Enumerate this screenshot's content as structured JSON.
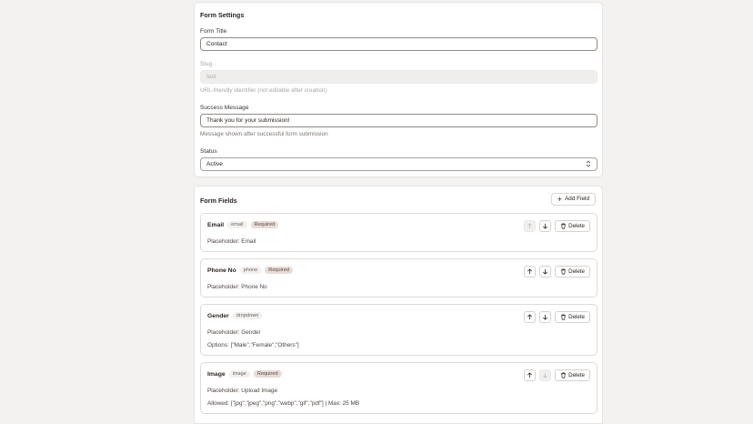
{
  "settings": {
    "title": "Form Settings",
    "form_title_label": "Form Title",
    "form_title_value": "Contact",
    "slug_label": "Slug",
    "slug_value": "test",
    "slug_help": "URL-friendly identifier (not editable after creation)",
    "success_label": "Success Message",
    "success_value": "Thank you for your submission!",
    "success_help": "Message shown after successful form submission",
    "status_label": "Status",
    "status_value": "Active"
  },
  "fields_section": {
    "title": "Form Fields",
    "add_label": "Add Field",
    "delete_label": "Delete",
    "items": [
      {
        "name": "Email",
        "type": "email",
        "required": "Required",
        "placeholder": "Placeholder: Email",
        "can_move_up": false,
        "can_move_down": true
      },
      {
        "name": "Phone No",
        "type": "phone",
        "required": "Required",
        "placeholder": "Placeholder: Phone No",
        "can_move_up": true,
        "can_move_down": true
      },
      {
        "name": "Gender",
        "type": "dropdown",
        "placeholder": "Placeholder: Gender",
        "extra": "Options: [\"Male\",\"Female\",\"Others\"]",
        "can_move_up": true,
        "can_move_down": true
      },
      {
        "name": "Image",
        "type": "image",
        "required": "Required",
        "placeholder": "Placeholder: Upload Image",
        "extra": "Allowed: [\"jpg\",\"jpeg\",\"png\",\"webp\",\"gif\",\"pdf\"] | Max: 25 MB",
        "can_move_up": true,
        "can_move_down": false
      }
    ]
  },
  "icons": {
    "up": "arrow-up-icon",
    "down": "arrow-down-icon",
    "delete": "trash-icon",
    "add": "plus-icon",
    "select": "chevron-up-down-icon"
  }
}
